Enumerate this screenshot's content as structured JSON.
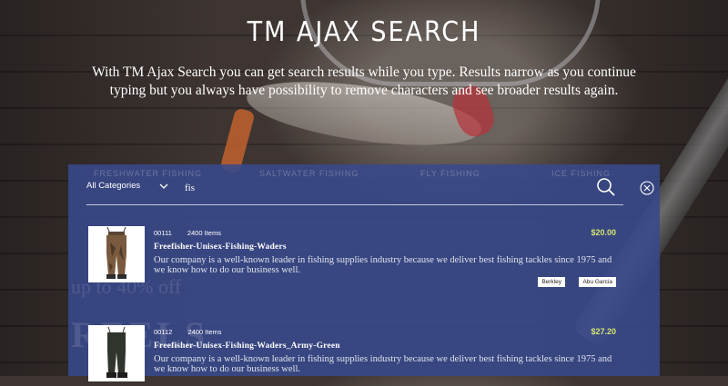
{
  "hero": {
    "title": "TM AJAX SEARCH",
    "description": "With TM Ajax Search you can get search results while you type. Results narrow as you continue typing but you always have possibility to remove characters and see broader results again."
  },
  "background_text": {
    "nav": [
      "FRESHWATER FISHING",
      "SALTWATER FISHING",
      "FLY FISHING",
      "ICE FISHING"
    ],
    "promo": "up to 40% off",
    "big": "REELS"
  },
  "search": {
    "category": "All Categories",
    "query": "fis"
  },
  "results": [
    {
      "sku": "00111",
      "items": "2400 Items",
      "name": "Freefisher-Unisex-Fishing-Waders",
      "description": "Our company is a well-known leader in fishing supplies industry because we deliver best fishing tackles since 1975 and we know how to do our business well.",
      "price": "$20.00",
      "tags": [
        "Berkley",
        "Abu Garcia"
      ],
      "image_icon": "waders-brown-icon"
    },
    {
      "sku": "00112",
      "items": "2400 Items",
      "name": "Freefisher-Unisex-Fishing-Waders_Army-Green",
      "description": "Our company is a well-known leader in fishing supplies industry because we deliver best fishing tackles since 1975 and we know how to do our business well.",
      "price": "$27.20",
      "tags": [],
      "image_icon": "waders-green-icon"
    }
  ],
  "colors": {
    "panel": "#38498c",
    "price": "#d5e56f",
    "text": "#ffffff"
  }
}
